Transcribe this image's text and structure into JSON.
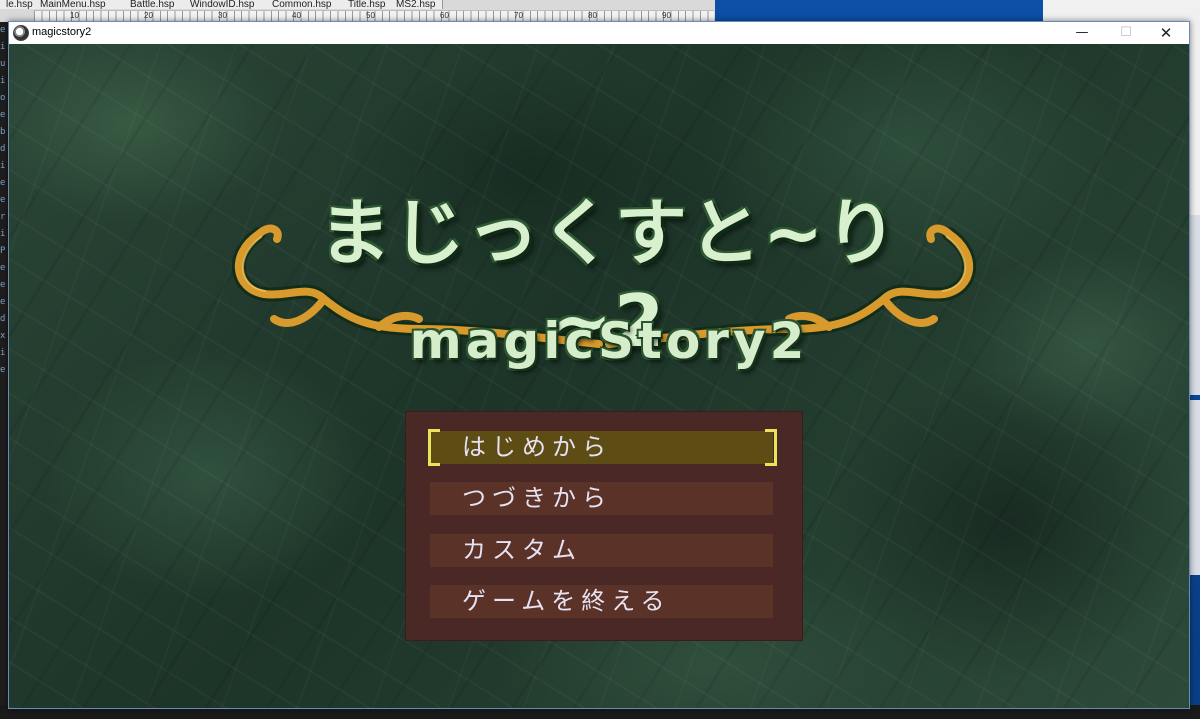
{
  "background_editor": {
    "tabs": [
      "le.hsp",
      "MainMenu.hsp",
      "Battle.hsp",
      "WindowID.hsp",
      "Common.hsp",
      "Title.hsp",
      "MS2.hsp"
    ],
    "ruler_marks": [
      "10",
      "20",
      "30",
      "40",
      "50",
      "60",
      "70",
      "80",
      "90"
    ],
    "gutter_letters": [
      "e",
      "i",
      "u",
      "i",
      "o",
      "e",
      "b",
      "d",
      "i",
      "e",
      "e",
      "r",
      "i",
      "P",
      "e",
      "e",
      "e",
      "d",
      "x",
      "i",
      "e"
    ]
  },
  "window": {
    "title": "magicstory2",
    "minimize_glyph": "—",
    "maximize_glyph": "☐",
    "close_glyph": "✕"
  },
  "game": {
    "logo": {
      "japanese": "まじっくすと~り~2",
      "english": "magicStory2",
      "vine_color": "#d89a2c",
      "text_color": "#d9f0cf"
    },
    "menu": {
      "items": [
        {
          "label": "はじめから",
          "selected": true
        },
        {
          "label": "つづきから",
          "selected": false
        },
        {
          "label": "カスタム",
          "selected": false
        },
        {
          "label": "ゲームを終える",
          "selected": false
        }
      ],
      "box_color": "#4a2826",
      "item_color": "#5a3227",
      "selected_color": "#5e4c15",
      "cursor_color": "#e9e35a"
    }
  }
}
